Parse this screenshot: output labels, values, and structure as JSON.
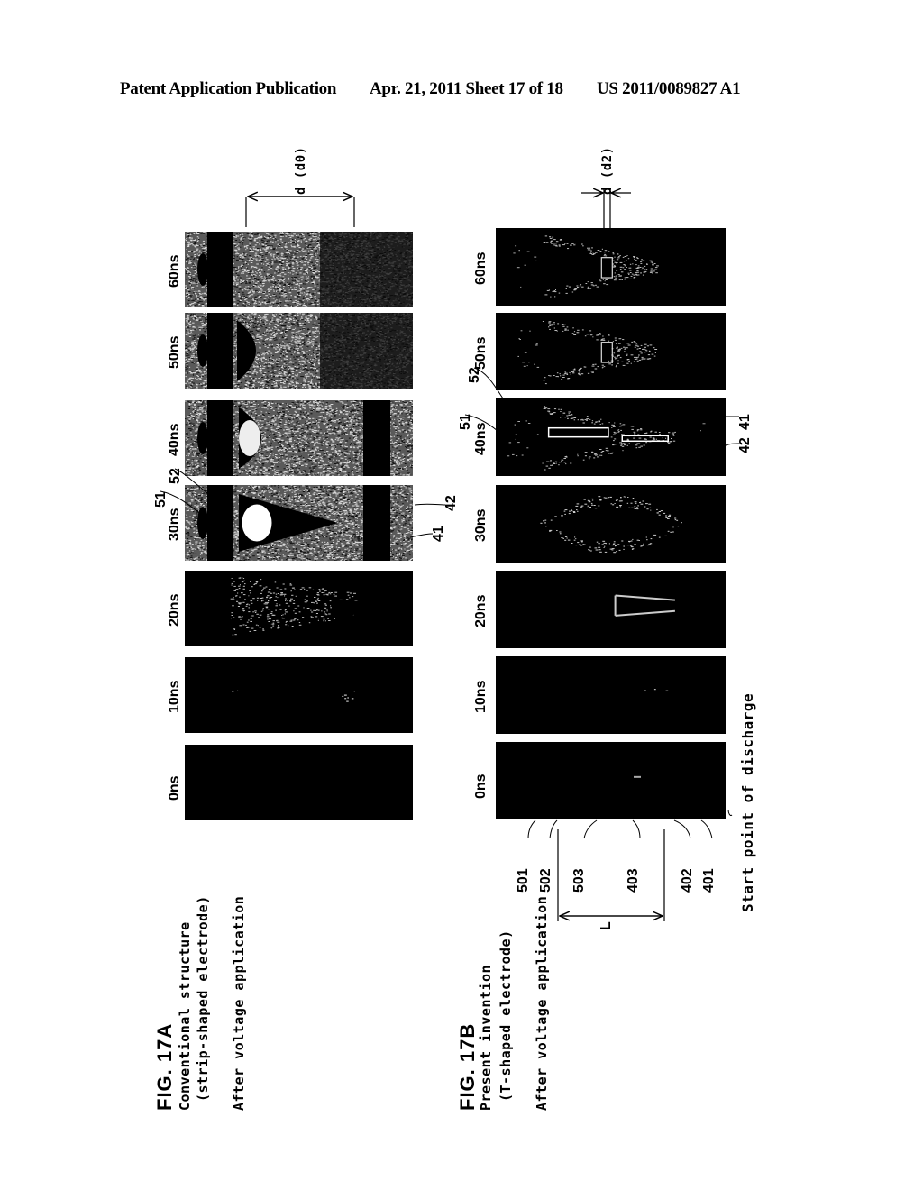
{
  "header": {
    "publication": "Patent Application Publication",
    "date_sheet": "Apr. 21, 2011  Sheet 17 of 18",
    "number": "US 2011/0089827 A1"
  },
  "fig17a": {
    "label": "FIG. 17A",
    "title_line1": "Conventional structure",
    "title_line2": "(strip-shaped electrode)",
    "subtitle": "After voltage application",
    "dimension_label": "d (d0)",
    "ref_51": "51",
    "ref_52": "52",
    "ref_41": "41",
    "ref_42": "42",
    "frames": [
      {
        "time": "0ns",
        "style": "dark"
      },
      {
        "time": "10ns",
        "style": "dark"
      },
      {
        "time": "20ns",
        "style": "dark"
      },
      {
        "time": "30ns",
        "style": "bright"
      },
      {
        "time": "40ns",
        "style": "bright"
      },
      {
        "time": "50ns",
        "style": "bright"
      },
      {
        "time": "60ns",
        "style": "bright"
      }
    ]
  },
  "fig17b": {
    "label": "FIG. 17B",
    "title_line1": "Present invention",
    "title_line2": "(T-shaped electrode)",
    "subtitle": "After voltage application",
    "dimension_label": "d (d2)",
    "length_label": "L",
    "start_point_label": "Start point of discharge",
    "ref_51": "51",
    "ref_52": "52",
    "ref_41": "41",
    "ref_42": "42",
    "bottom_refs": [
      "501",
      "502",
      "503",
      "403",
      "402",
      "401"
    ],
    "frames": [
      {
        "time": "0ns"
      },
      {
        "time": "10ns"
      },
      {
        "time": "20ns"
      },
      {
        "time": "30ns"
      },
      {
        "time": "40ns"
      },
      {
        "time": "50ns"
      },
      {
        "time": "60ns"
      }
    ]
  }
}
